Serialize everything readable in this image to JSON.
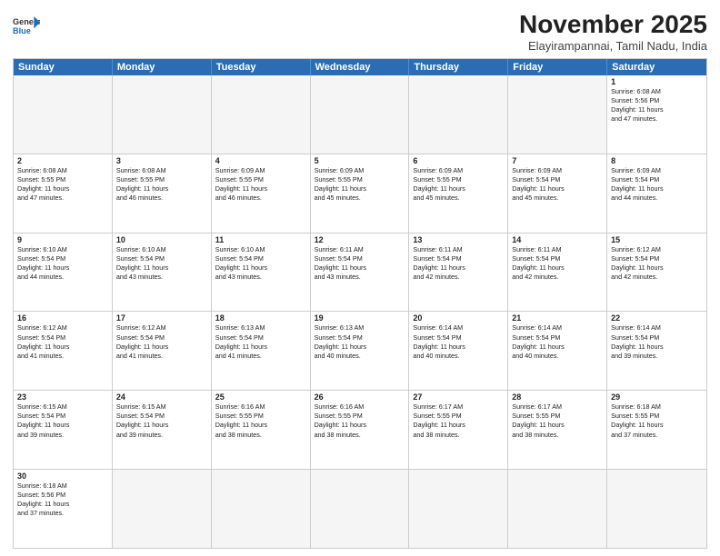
{
  "header": {
    "logo_general": "General",
    "logo_blue": "Blue",
    "month": "November 2025",
    "location": "Elayirampannai, Tamil Nadu, India"
  },
  "days": [
    "Sunday",
    "Monday",
    "Tuesday",
    "Wednesday",
    "Thursday",
    "Friday",
    "Saturday"
  ],
  "rows": [
    [
      {
        "day": "",
        "content": ""
      },
      {
        "day": "",
        "content": ""
      },
      {
        "day": "",
        "content": ""
      },
      {
        "day": "",
        "content": ""
      },
      {
        "day": "",
        "content": ""
      },
      {
        "day": "",
        "content": ""
      },
      {
        "day": "1",
        "content": "Sunrise: 6:08 AM\nSunset: 5:56 PM\nDaylight: 11 hours\nand 47 minutes."
      }
    ],
    [
      {
        "day": "2",
        "content": "Sunrise: 6:08 AM\nSunset: 5:55 PM\nDaylight: 11 hours\nand 47 minutes."
      },
      {
        "day": "3",
        "content": "Sunrise: 6:08 AM\nSunset: 5:55 PM\nDaylight: 11 hours\nand 46 minutes."
      },
      {
        "day": "4",
        "content": "Sunrise: 6:09 AM\nSunset: 5:55 PM\nDaylight: 11 hours\nand 46 minutes."
      },
      {
        "day": "5",
        "content": "Sunrise: 6:09 AM\nSunset: 5:55 PM\nDaylight: 11 hours\nand 45 minutes."
      },
      {
        "day": "6",
        "content": "Sunrise: 6:09 AM\nSunset: 5:55 PM\nDaylight: 11 hours\nand 45 minutes."
      },
      {
        "day": "7",
        "content": "Sunrise: 6:09 AM\nSunset: 5:54 PM\nDaylight: 11 hours\nand 45 minutes."
      },
      {
        "day": "8",
        "content": "Sunrise: 6:09 AM\nSunset: 5:54 PM\nDaylight: 11 hours\nand 44 minutes."
      }
    ],
    [
      {
        "day": "9",
        "content": "Sunrise: 6:10 AM\nSunset: 5:54 PM\nDaylight: 11 hours\nand 44 minutes."
      },
      {
        "day": "10",
        "content": "Sunrise: 6:10 AM\nSunset: 5:54 PM\nDaylight: 11 hours\nand 43 minutes."
      },
      {
        "day": "11",
        "content": "Sunrise: 6:10 AM\nSunset: 5:54 PM\nDaylight: 11 hours\nand 43 minutes."
      },
      {
        "day": "12",
        "content": "Sunrise: 6:11 AM\nSunset: 5:54 PM\nDaylight: 11 hours\nand 43 minutes."
      },
      {
        "day": "13",
        "content": "Sunrise: 6:11 AM\nSunset: 5:54 PM\nDaylight: 11 hours\nand 42 minutes."
      },
      {
        "day": "14",
        "content": "Sunrise: 6:11 AM\nSunset: 5:54 PM\nDaylight: 11 hours\nand 42 minutes."
      },
      {
        "day": "15",
        "content": "Sunrise: 6:12 AM\nSunset: 5:54 PM\nDaylight: 11 hours\nand 42 minutes."
      }
    ],
    [
      {
        "day": "16",
        "content": "Sunrise: 6:12 AM\nSunset: 5:54 PM\nDaylight: 11 hours\nand 41 minutes."
      },
      {
        "day": "17",
        "content": "Sunrise: 6:12 AM\nSunset: 5:54 PM\nDaylight: 11 hours\nand 41 minutes."
      },
      {
        "day": "18",
        "content": "Sunrise: 6:13 AM\nSunset: 5:54 PM\nDaylight: 11 hours\nand 41 minutes."
      },
      {
        "day": "19",
        "content": "Sunrise: 6:13 AM\nSunset: 5:54 PM\nDaylight: 11 hours\nand 40 minutes."
      },
      {
        "day": "20",
        "content": "Sunrise: 6:14 AM\nSunset: 5:54 PM\nDaylight: 11 hours\nand 40 minutes."
      },
      {
        "day": "21",
        "content": "Sunrise: 6:14 AM\nSunset: 5:54 PM\nDaylight: 11 hours\nand 40 minutes."
      },
      {
        "day": "22",
        "content": "Sunrise: 6:14 AM\nSunset: 5:54 PM\nDaylight: 11 hours\nand 39 minutes."
      }
    ],
    [
      {
        "day": "23",
        "content": "Sunrise: 6:15 AM\nSunset: 5:54 PM\nDaylight: 11 hours\nand 39 minutes."
      },
      {
        "day": "24",
        "content": "Sunrise: 6:15 AM\nSunset: 5:54 PM\nDaylight: 11 hours\nand 39 minutes."
      },
      {
        "day": "25",
        "content": "Sunrise: 6:16 AM\nSunset: 5:55 PM\nDaylight: 11 hours\nand 38 minutes."
      },
      {
        "day": "26",
        "content": "Sunrise: 6:16 AM\nSunset: 5:55 PM\nDaylight: 11 hours\nand 38 minutes."
      },
      {
        "day": "27",
        "content": "Sunrise: 6:17 AM\nSunset: 5:55 PM\nDaylight: 11 hours\nand 38 minutes."
      },
      {
        "day": "28",
        "content": "Sunrise: 6:17 AM\nSunset: 5:55 PM\nDaylight: 11 hours\nand 38 minutes."
      },
      {
        "day": "29",
        "content": "Sunrise: 6:18 AM\nSunset: 5:55 PM\nDaylight: 11 hours\nand 37 minutes."
      }
    ],
    [
      {
        "day": "30",
        "content": "Sunrise: 6:18 AM\nSunset: 5:56 PM\nDaylight: 11 hours\nand 37 minutes."
      },
      {
        "day": "",
        "content": ""
      },
      {
        "day": "",
        "content": ""
      },
      {
        "day": "",
        "content": ""
      },
      {
        "day": "",
        "content": ""
      },
      {
        "day": "",
        "content": ""
      },
      {
        "day": "",
        "content": ""
      }
    ]
  ]
}
